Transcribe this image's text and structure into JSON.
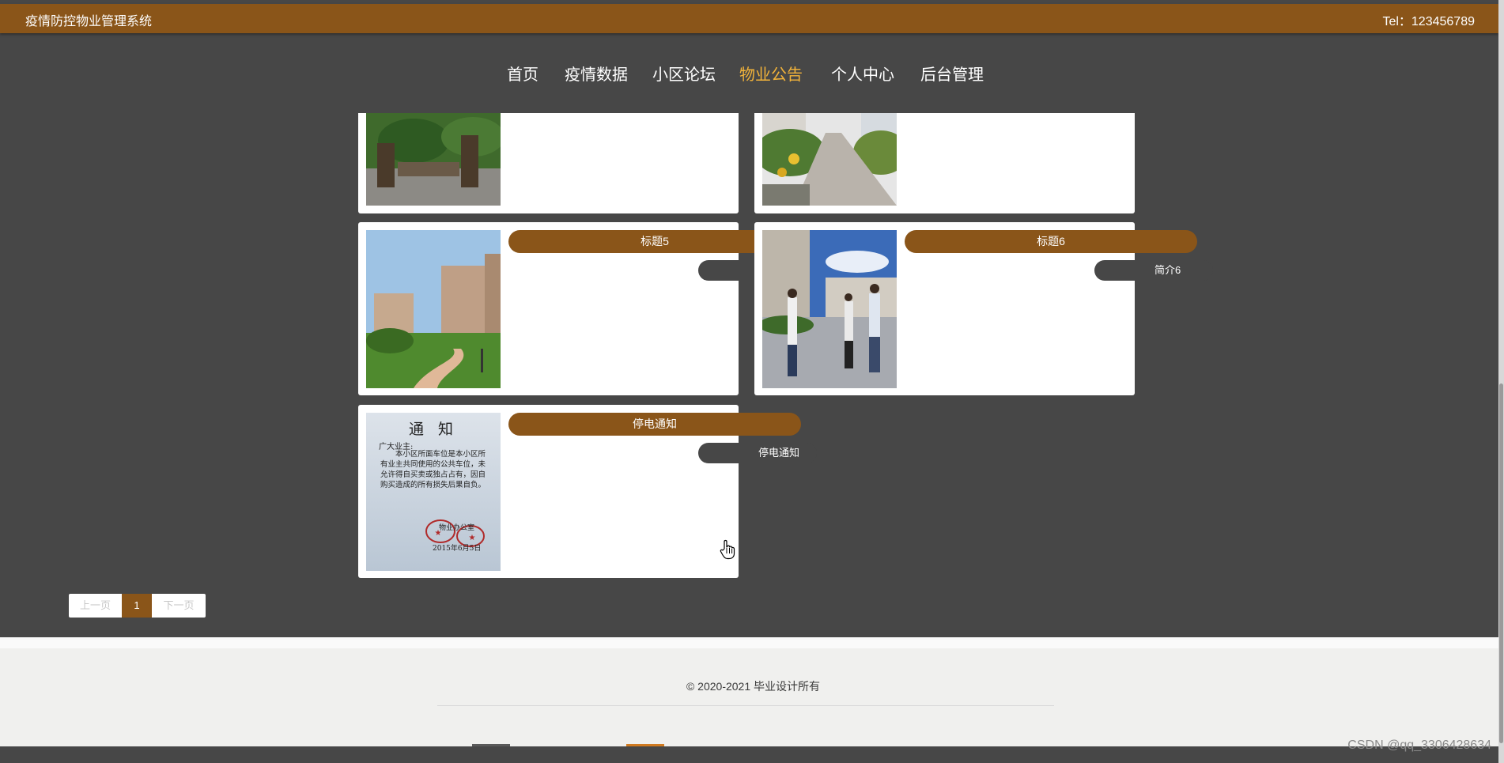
{
  "header": {
    "site_title": "疫情防控物业管理系统",
    "tel": "Tel：123456789"
  },
  "nav": {
    "items": [
      {
        "label": "首页"
      },
      {
        "label": "疫情数据"
      },
      {
        "label": "小区论坛"
      },
      {
        "label": "物业公告",
        "active": true
      },
      {
        "label": "个人中心"
      },
      {
        "label": "后台管理"
      }
    ]
  },
  "notices": [
    {
      "title": "",
      "summary": ""
    },
    {
      "title": "",
      "summary": ""
    },
    {
      "title": "标题5",
      "summary": ""
    },
    {
      "title": "标题6",
      "summary": "简介6"
    },
    {
      "title": "停电通知",
      "summary": "停电通知"
    }
  ],
  "notice_image": {
    "heading": "通 知",
    "salutation": "广大业主:",
    "body": "本小区所面车位是本小区所有业主共同使用的公共车位，未允许得自买卖或独占占有，因自购买造成的所有损失后果自负。",
    "signature": "物业办公室",
    "date": "2015年6月5日"
  },
  "pagination": {
    "prev_label": "上一页",
    "current": "1",
    "next_label": "下一页"
  },
  "footer": {
    "copyright": "© 2020-2021 毕业设计所有"
  },
  "watermark": "CSDN @qq_3306428634",
  "colors": {
    "brand": "#8a5519",
    "active_nav": "#f2b33a",
    "page_bg": "#474747"
  }
}
